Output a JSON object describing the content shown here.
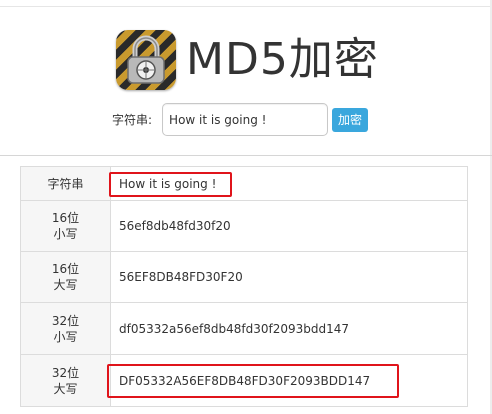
{
  "header": {
    "title": "MD5加密",
    "logo_icon": "padlock-icon"
  },
  "form": {
    "label": "字符串:",
    "input_value": "How it is going !",
    "submit_label": "加密"
  },
  "results": {
    "rows": [
      {
        "key": [
          "字符串"
        ],
        "value": "How it is going !"
      },
      {
        "key": [
          "16位",
          "小写"
        ],
        "value": "56ef8db48fd30f20"
      },
      {
        "key": [
          "16位",
          "大写"
        ],
        "value": "56EF8DB48FD30F20"
      },
      {
        "key": [
          "32位",
          "小写"
        ],
        "value": "df05332a56ef8db48fd30f2093bdd147"
      },
      {
        "key": [
          "32位",
          "大写"
        ],
        "value": "DF05332A56EF8DB48FD30F2093BDD147"
      }
    ]
  },
  "colors": {
    "accent": "#3aa7dd",
    "highlight": "#e0141b"
  }
}
